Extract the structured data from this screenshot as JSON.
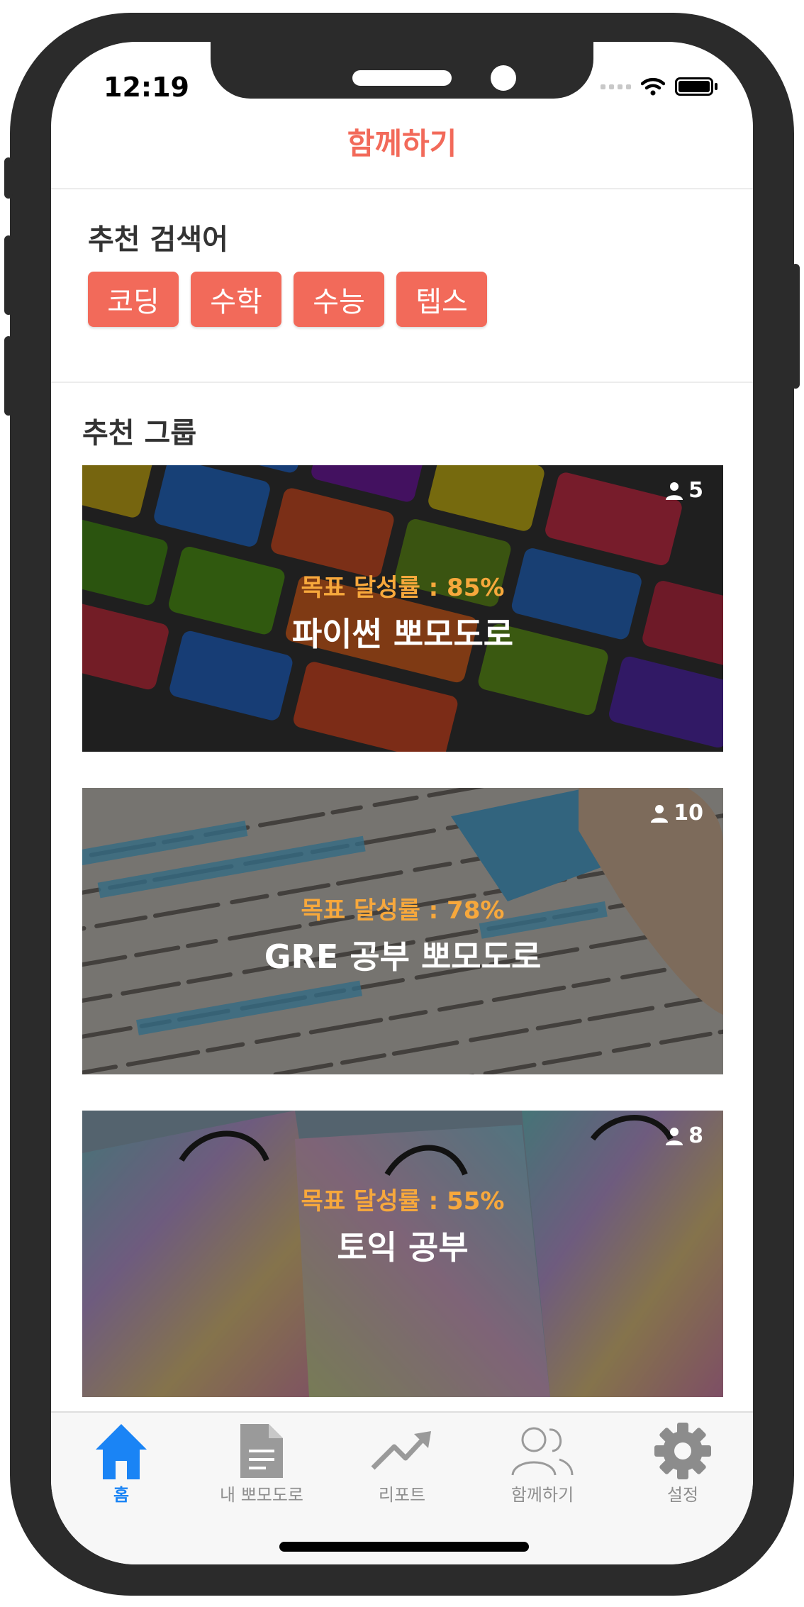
{
  "status_bar": {
    "time": "12:19"
  },
  "header": {
    "title": "함께하기"
  },
  "recommended_search": {
    "title": "추천 검색어",
    "keywords": [
      "코딩",
      "수학",
      "수능",
      "텝스"
    ]
  },
  "recommended_groups": {
    "title": "추천 그룹",
    "cards": [
      {
        "rate_label": "목표 달성률 : 85%",
        "name": "파이썬 뽀모도로",
        "members": "5",
        "theme": "keyboard"
      },
      {
        "rate_label": "목표 달성률 : 78%",
        "name": "GRE 공부 뽀모도로",
        "members": "10",
        "theme": "text"
      },
      {
        "rate_label": "목표 달성률 : 55%",
        "name": "토익 공부",
        "members": "8",
        "theme": "bags"
      }
    ]
  },
  "tabbar": {
    "items": [
      {
        "label": "홈",
        "icon": "home-icon",
        "active": true
      },
      {
        "label": "내 뽀모도로",
        "icon": "document-icon",
        "active": false
      },
      {
        "label": "리포트",
        "icon": "trend-icon",
        "active": false
      },
      {
        "label": "함께하기",
        "icon": "people-icon",
        "active": false
      },
      {
        "label": "설정",
        "icon": "gear-icon",
        "active": false
      }
    ]
  },
  "colors": {
    "accent": "#f26a5a",
    "rate": "#f7a83c",
    "tab_active": "#1a84f5",
    "tab_inactive": "#8e8e8e"
  }
}
